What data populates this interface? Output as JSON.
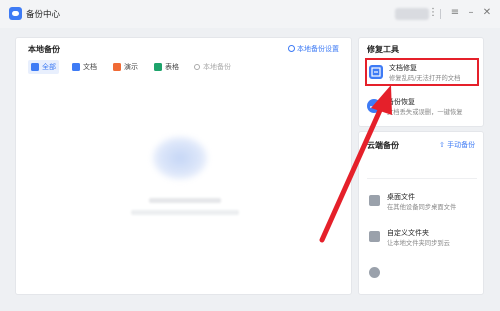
{
  "app": {
    "title": "备份中心",
    "icon": "backup-logo-icon"
  },
  "titlebar": {
    "menu_icon": "menu-icon",
    "minimize_icon": "minimize-icon",
    "close_icon": "close-icon",
    "more_icon": "more-icon"
  },
  "local_backup": {
    "title": "本地备份",
    "settings_label": "本地备份设置",
    "filters": [
      {
        "label": "全部",
        "color": "#3e7bf5",
        "active": true
      },
      {
        "label": "文档",
        "color": "#3e7bf5",
        "active": false
      },
      {
        "label": "演示",
        "color": "#f06a35",
        "active": false
      },
      {
        "label": "表格",
        "color": "#1ea36b",
        "active": false
      }
    ],
    "search_placeholder": "本地备份"
  },
  "repair_tools": {
    "title": "修复工具",
    "items": [
      {
        "name": "文档修复",
        "desc": "修复乱码/无法打开的文档",
        "color": "#3e7bf5"
      },
      {
        "name": "备份恢复",
        "desc": "文档丢失或误删，一键恢复",
        "color": "#3e7bf5"
      }
    ]
  },
  "cloud_backup": {
    "title": "云端备份",
    "manual_label": "手动备份",
    "items": [
      {
        "name": "桌面文件",
        "desc": "在其他设备同步桌面文件"
      },
      {
        "name": "自定义文件夹",
        "desc": "让本地文件夹同步到云"
      }
    ]
  },
  "colors": {
    "accent": "#3e7bf5",
    "highlight": "#e5202a"
  }
}
